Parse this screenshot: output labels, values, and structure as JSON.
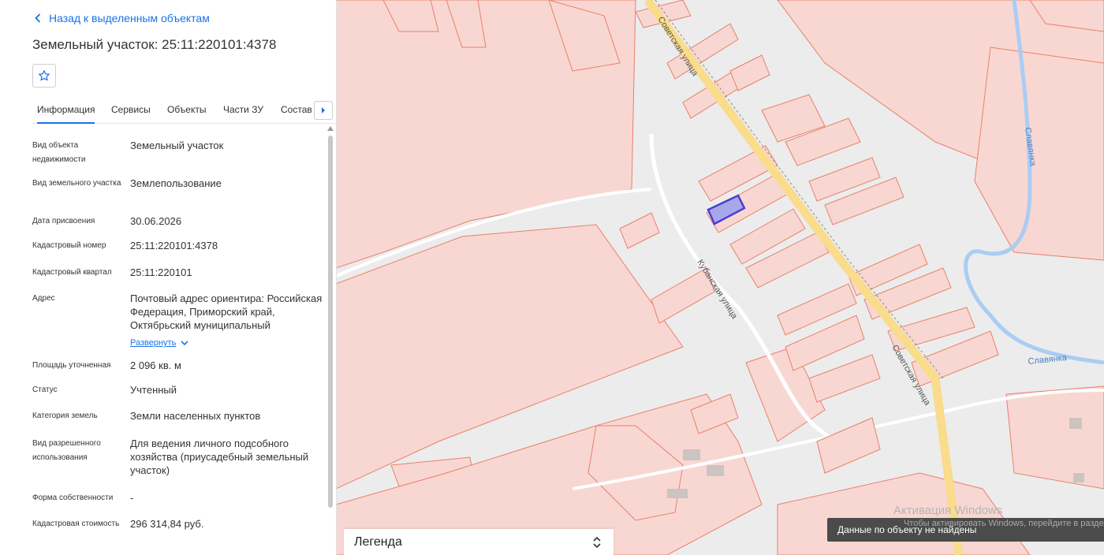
{
  "panel": {
    "back_label": "Назад к выделенным объектам",
    "title": "Земельный участок: 25:11:220101:4378",
    "tabs": [
      "Информация",
      "Сервисы",
      "Объекты",
      "Части ЗУ",
      "Состав"
    ],
    "active_tab": "Информация",
    "expand_label": "Развернуть"
  },
  "info": [
    {
      "label": "Вид объекта недвижимости",
      "value": "Земельный участок"
    },
    {
      "label": "Вид земельного участка",
      "value": "Землепользование"
    },
    {
      "label": "Дата присвоения",
      "value": "30.06.2026"
    },
    {
      "label": "Кадастровый номер",
      "value": "25:11:220101:4378"
    },
    {
      "label": "Кадастровый квартал",
      "value": "25:11:220101"
    },
    {
      "label": "Адрес",
      "value": "Почтовый адрес ориентира: Российская Федерация, Приморский край, Октябрьский муниципальный"
    },
    {
      "label": "Площадь уточненная",
      "value": "2 096 кв. м"
    },
    {
      "label": "Статус",
      "value": "Учтенный"
    },
    {
      "label": "Категория земель",
      "value": "Земли населенных пунктов"
    },
    {
      "label": "Вид разрешенного использования",
      "value": "Для ведения личного подсобного хозяйства (приусадебный земельный участок)"
    },
    {
      "label": "Форма собственности",
      "value": "-"
    },
    {
      "label": "Кадастровая стоимость",
      "value": "296 314,84 руб."
    }
  ],
  "map": {
    "street_labels": [
      "Советская улица",
      "Кубанская улица",
      "Советская улица"
    ],
    "river_labels": [
      "Славянка",
      "Славянка"
    ],
    "colors": {
      "parcel_fill": "#f8d7d2",
      "parcel_stroke": "#e8806a",
      "road": "#f9dc8c",
      "river": "#a9cdf3",
      "selected": "#4a3fcf"
    }
  },
  "legend": {
    "label": "Легенда"
  },
  "toast": {
    "message": "Данные по объекту не найдены"
  },
  "watermark": {
    "title": "Активация Windows",
    "text": "Чтобы активировать Windows, перейдите в раздел"
  }
}
